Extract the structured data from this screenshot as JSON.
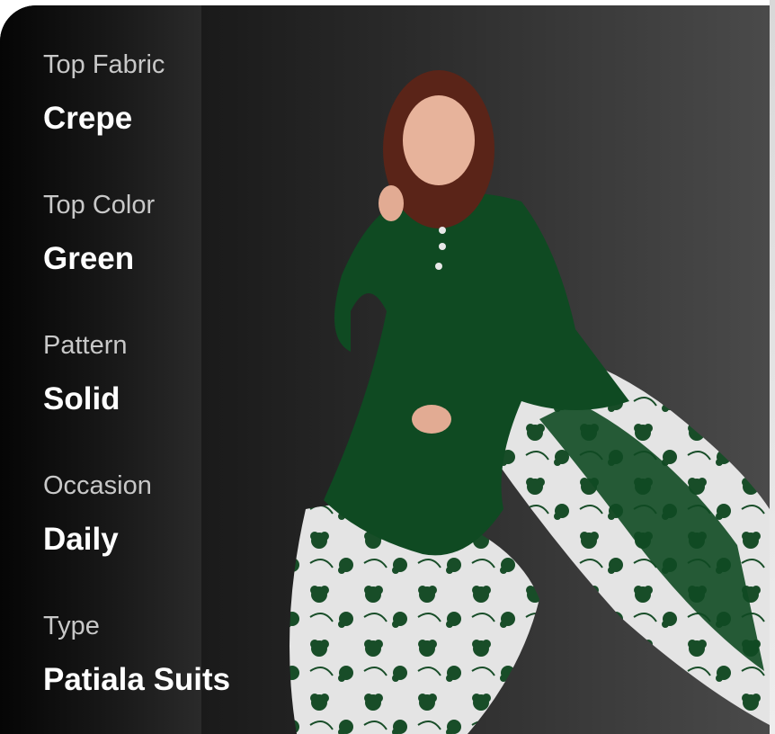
{
  "attributes": [
    {
      "label": "Top Fabric",
      "value": "Crepe"
    },
    {
      "label": "Top Color",
      "value": "Green"
    },
    {
      "label": "Pattern",
      "value": "Solid"
    },
    {
      "label": "Occasion",
      "value": "Daily"
    },
    {
      "label": "Type",
      "value": "Patiala Suits"
    }
  ],
  "product": {
    "image": "woman-in-green-kurta-with-white-floral-patiala-and-dupatta",
    "colors": {
      "kurta": "#0f4a22",
      "print_base": "#e6e6e6",
      "print_flowers": "#164a26"
    }
  }
}
